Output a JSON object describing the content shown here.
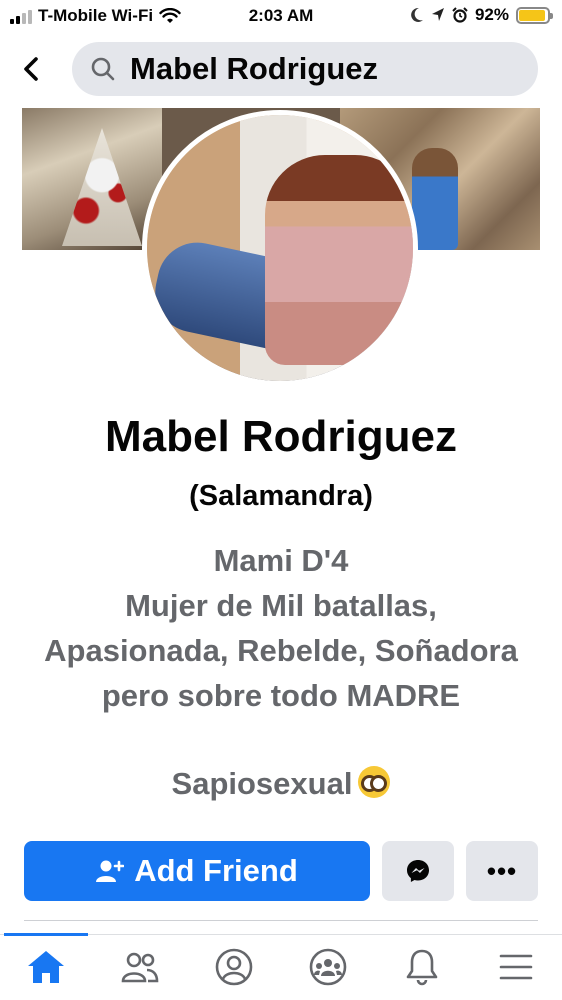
{
  "status_bar": {
    "carrier": "T-Mobile Wi-Fi",
    "time": "2:03 AM",
    "battery_percent": "92%",
    "battery_level": 0.92,
    "icons": [
      "signal-icon",
      "wifi-icon",
      "moon-icon",
      "location-arrow-icon",
      "alarm-icon",
      "battery-icon"
    ]
  },
  "header": {
    "back_icon": "chevron-left-icon",
    "search_icon": "search-icon",
    "search_text": "Mabel Rodriguez"
  },
  "profile": {
    "name": "Mabel Rodriguez",
    "alias": "(Salamandra)",
    "bio_lines": [
      "Mami D'4",
      "Mujer de Mil batallas,",
      "Apasionada, Rebelde, Soñadora",
      "pero sobre todo MADRE"
    ],
    "bio_extra": "Sapiosexual",
    "bio_emoji": "nerd-face-emoji"
  },
  "actions": {
    "add_friend_label": "Add Friend",
    "add_friend_icon": "add-person-icon",
    "message_icon": "messenger-icon",
    "more_label": "•••"
  },
  "tabs": [
    {
      "name": "home",
      "icon": "home-icon",
      "active": true
    },
    {
      "name": "friends",
      "icon": "friends-icon",
      "active": false
    },
    {
      "name": "profile",
      "icon": "profile-icon",
      "active": false
    },
    {
      "name": "groups",
      "icon": "groups-icon",
      "active": false
    },
    {
      "name": "notifications",
      "icon": "bell-icon",
      "active": false
    },
    {
      "name": "menu",
      "icon": "menu-icon",
      "active": false
    }
  ],
  "colors": {
    "accent": "#1877f2",
    "secondary_button": "#e4e6eb",
    "muted_text": "#65676b",
    "battery": "#f5c518"
  }
}
